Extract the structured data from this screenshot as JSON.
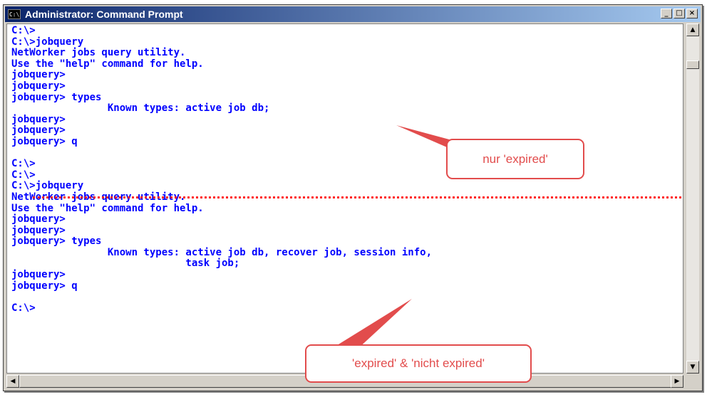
{
  "window": {
    "title": "Administrator: Command Prompt",
    "icon_label": "C:\\",
    "controls": {
      "minimize": "_",
      "maximize": "□",
      "close": "×"
    }
  },
  "console": {
    "lines": [
      "C:\\>",
      "C:\\>jobquery",
      "NetWorker jobs query utility.",
      "Use the \"help\" command for help.",
      "jobquery>",
      "jobquery>",
      "jobquery> types",
      "                Known types: active job db;",
      "jobquery>",
      "jobquery>",
      "jobquery> q",
      "",
      "C:\\>",
      "C:\\>",
      "C:\\>jobquery",
      "NetWorker jobs query utility.",
      "Use the \"help\" command for help.",
      "jobquery>",
      "jobquery>",
      "jobquery> types",
      "                Known types: active job db, recover job, session info,",
      "                             task job;",
      "jobquery>",
      "jobquery> q",
      "",
      "C:\\>"
    ]
  },
  "annotations": {
    "callout_1": "nur 'expired'",
    "callout_2": "'expired' & 'nicht expired'",
    "accent_color": "#e24c4c",
    "separator_color": "#ff2020"
  },
  "scrollbars": {
    "up_arrow": "▲",
    "down_arrow": "▼",
    "left_arrow": "◀",
    "right_arrow": "▶"
  }
}
